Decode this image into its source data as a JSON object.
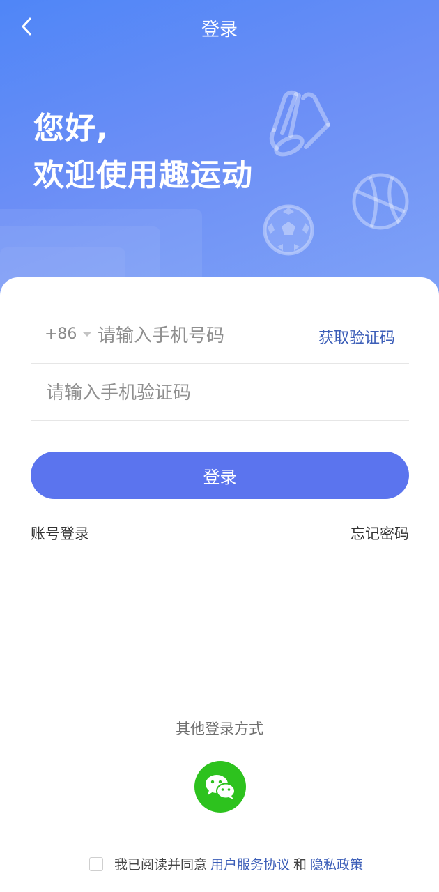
{
  "nav": {
    "title": "登录",
    "back_icon": "chevron-left-icon"
  },
  "header": {
    "greeting_line1": "您好,",
    "greeting_line2": "欢迎使用趣运动",
    "icons": [
      "badminton-shuttlecock-icon",
      "soccer-ball-icon",
      "basketball-icon"
    ]
  },
  "form": {
    "country_code": "+86",
    "phone_placeholder": "请输入手机号码",
    "get_code_label": "获取验证码",
    "code_placeholder": "请输入手机验证码",
    "login_label": "登录"
  },
  "links": {
    "account_login": "账号登录",
    "forgot_password": "忘记密码"
  },
  "other_login": {
    "title": "其他登录方式",
    "icon": "wechat-icon"
  },
  "agreement": {
    "prefix": "我已阅读并同意",
    "user_agreement": "用户服务协议",
    "and": "和",
    "privacy_policy": "隐私政策"
  },
  "colors": {
    "header_gradient_start": "#4f86f7",
    "header_gradient_end": "#7fa2f7",
    "primary_button": "#5b74ee",
    "link_blue": "#3d5fb8",
    "wechat_green": "#2dc21e"
  }
}
